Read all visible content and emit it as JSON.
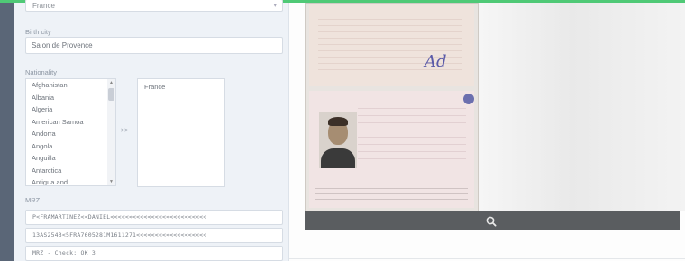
{
  "form": {
    "select_value": "France",
    "birth_city": {
      "label": "Birth city",
      "value": "Salon de Provence"
    },
    "nationality": {
      "label": "Nationality",
      "options": [
        "Afghanistan",
        "Albania",
        "Algeria",
        "American Samoa",
        "Andorra",
        "Angola",
        "Anguilla",
        "Antarctica",
        "Antigua and"
      ],
      "move_button": ">>",
      "selected": [
        "France"
      ]
    },
    "mrz": {
      "label": "MRZ",
      "lines": [
        "P<FRAMARTINEZ<<DANIEL<<<<<<<<<<<<<<<<<<<<<<<<<<",
        "13AS2543<5FRA7605281M1611271<<<<<<<<<<<<<<<<<<<",
        "MRZ - Check: OK 3"
      ]
    }
  },
  "viewer": {
    "zoom_icon": "magnifier-icon"
  },
  "colors": {
    "accent": "#4fc976",
    "sidebar": "#5a6677",
    "panel": "#eef2f7",
    "toolbar": "#5a5d60"
  }
}
